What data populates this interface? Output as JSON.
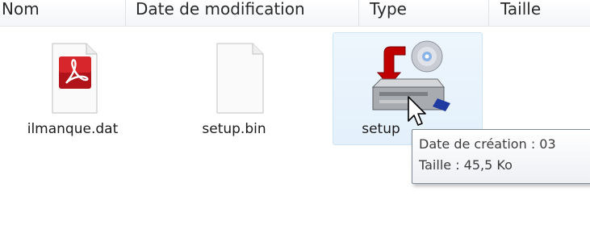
{
  "header": {
    "columns": [
      "Nom",
      "Date de modification",
      "Type",
      "Taille"
    ]
  },
  "files": [
    {
      "name": "ilmanque.dat",
      "icon": "pdf-file-icon"
    },
    {
      "name": "setup.bin",
      "icon": "blank-file-icon"
    },
    {
      "name": "setup",
      "icon": "installer-icon"
    }
  ],
  "tooltip": {
    "line1": "Date de création : 03",
    "line2": "Taille : 45,5 Ko"
  },
  "colors": {
    "accent_red": "#c00000",
    "selection": "#e3f0fb"
  }
}
